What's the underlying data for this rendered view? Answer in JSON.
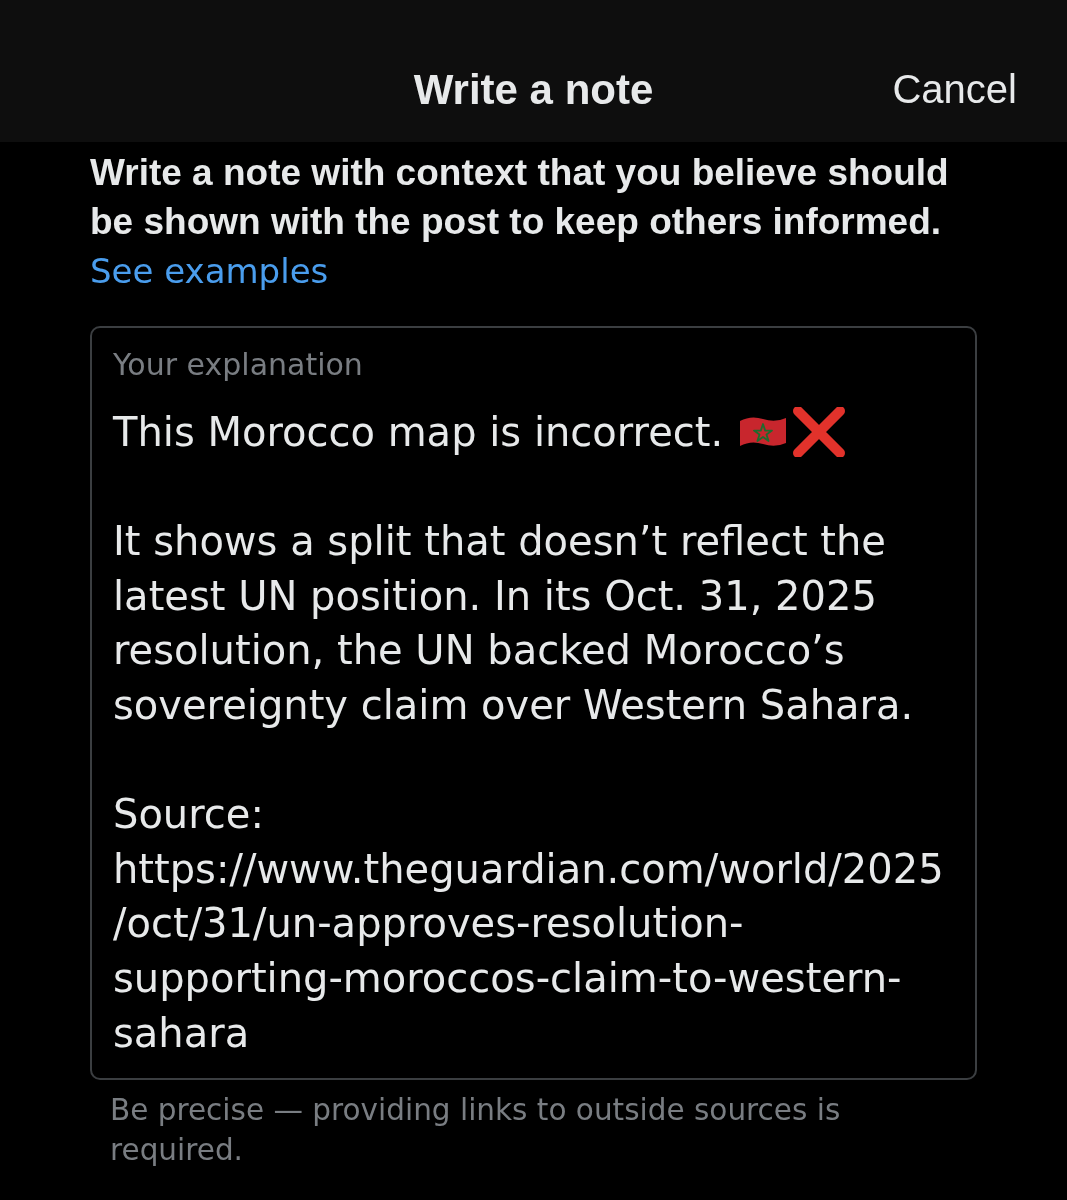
{
  "header": {
    "title": "Write a note",
    "cancel": "Cancel"
  },
  "intro": {
    "lines": [
      "Write a note with context that you believe should",
      "be shown with the post to keep others informed."
    ],
    "link": "See examples"
  },
  "note_field": {
    "label": "Your explanation",
    "paragraphs": [
      {
        "lines": [
          "This Morocco map is incorrect."
        ]
      },
      {
        "lines": [
          "It shows a split that doesn’t reflect the",
          "latest UN position. In its Oct. 31, 2025",
          "resolution, the UN backed Morocco’s",
          "sovereignty claim over Western Sahara."
        ]
      },
      {
        "lines": [
          "Source:",
          "https://www.theguardian.com/world/2025",
          "/oct/31/un-approves-resolution-",
          "supporting-moroccos-claim-to-western-",
          "sahara"
        ]
      }
    ]
  },
  "helper": {
    "lines": [
      "Be precise — providing links to outside sources is",
      "required."
    ]
  }
}
